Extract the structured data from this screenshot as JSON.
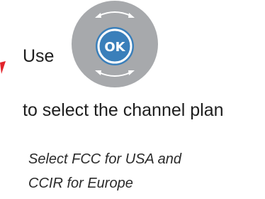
{
  "step": {
    "prefix_text": "Use",
    "button_label": "OK",
    "instruction_text": "to select the channel plan"
  },
  "note": {
    "line1": "Select FCC for USA and",
    "line2": "CCIR for Europe"
  },
  "colors": {
    "accent_red": "#e2232a",
    "dial_gray": "#a7a9ac",
    "ok_blue": "#3a7fba"
  },
  "icons": {
    "dial": "navigation-dial-icon",
    "arrow_top": "rotate-arrow-icon",
    "arrow_bottom": "rotate-arrow-icon",
    "pointer": "red-pointer-mark"
  }
}
